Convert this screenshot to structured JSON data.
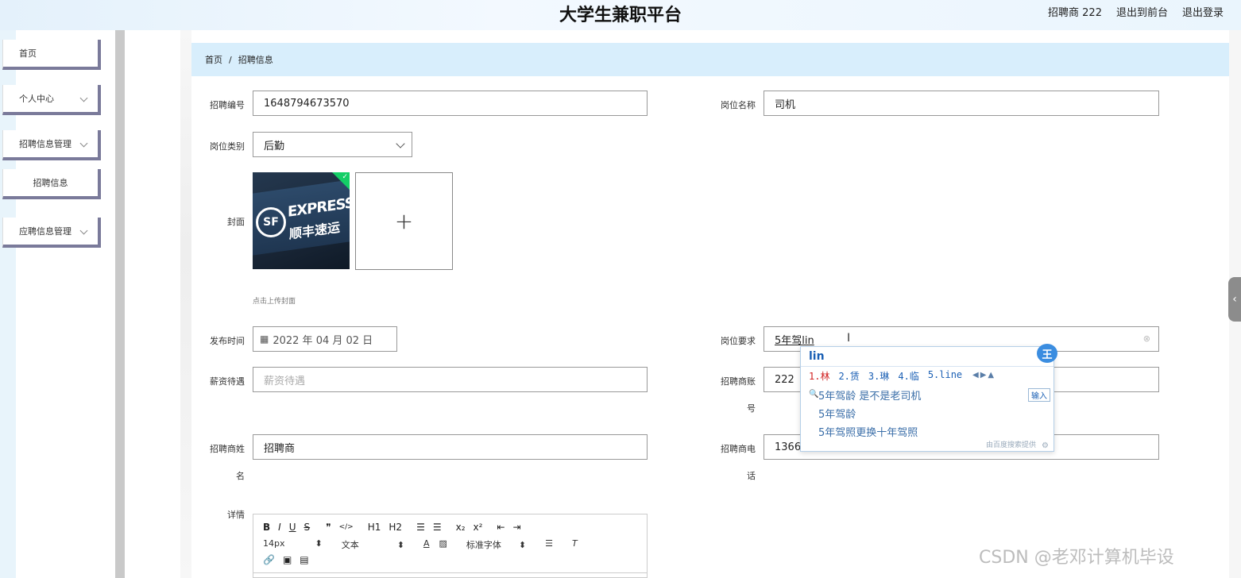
{
  "header": {
    "site_title": "大学生兼职平台",
    "user_label": "招聘商 222",
    "to_front_label": "退出到前台",
    "logout_label": "退出登录"
  },
  "sidebar": {
    "items": [
      {
        "label": "首页"
      },
      {
        "label": "个人中心"
      },
      {
        "label": "招聘信息管理"
      },
      {
        "label": "招聘信息"
      },
      {
        "label": "应聘信息管理"
      }
    ]
  },
  "breadcrumb": {
    "home": "首页",
    "sep": "/",
    "current": "招聘信息"
  },
  "form": {
    "recruit_no_label": "招聘编号",
    "recruit_no_value": "1648794673570",
    "position_name_label": "岗位名称",
    "position_name_value": "司机",
    "position_type_label": "岗位类别",
    "position_type_value": "后勤",
    "cover_label": "封面",
    "cover_upload_plus": "+",
    "cover_hint": "点击上传封面",
    "cover_image": {
      "brand_top": "EXPRESS",
      "brand_cn": "顺丰速运",
      "brand_logo": "SF"
    },
    "publish_time_label": "发布时间",
    "publish_time_value": "2022 年 04 月 02 日",
    "requirement_label": "岗位要求",
    "requirement_value": "5年驾lin",
    "salary_label": "薪资待遇",
    "salary_placeholder": "薪资待遇",
    "account_label_1": "招聘商账",
    "account_label_2": "号",
    "account_value": "222",
    "name_label_1": "招聘商姓",
    "name_label_2": "名",
    "name_value": "招聘商",
    "phone_label_1": "招聘商电",
    "phone_label_2": "话",
    "phone_value": "13666",
    "detail_label": "详情"
  },
  "editor": {
    "row1": [
      "B",
      "I",
      "U",
      "S",
      "❞",
      "</>",
      "H1",
      "H2",
      "☰",
      "☰",
      "x₂",
      "x²",
      "⇤",
      "⇥"
    ],
    "font_size": "14px",
    "text_type": "文本",
    "font_family": "标准字体",
    "row3": [
      "🔗",
      "▣",
      "▤"
    ]
  },
  "ime": {
    "composition": "lin",
    "candidates": [
      "1.林",
      "2.赁",
      "3.琳",
      "4.临",
      "5.line"
    ],
    "nav": "◀▶▲",
    "suggestions": [
      "5年驾龄 是不是老司机",
      "5年驾龄",
      "5年驾照更换十年驾照"
    ],
    "input_button": "输入",
    "footer": "由百度搜索提供",
    "badge": "王"
  },
  "watermark": "CSDN @老邓计算机毕设",
  "colors": {
    "breadcrumb_bg": "#d8eefc",
    "menu_border": "#7a7a9a",
    "upload_ok": "#13ce66"
  }
}
